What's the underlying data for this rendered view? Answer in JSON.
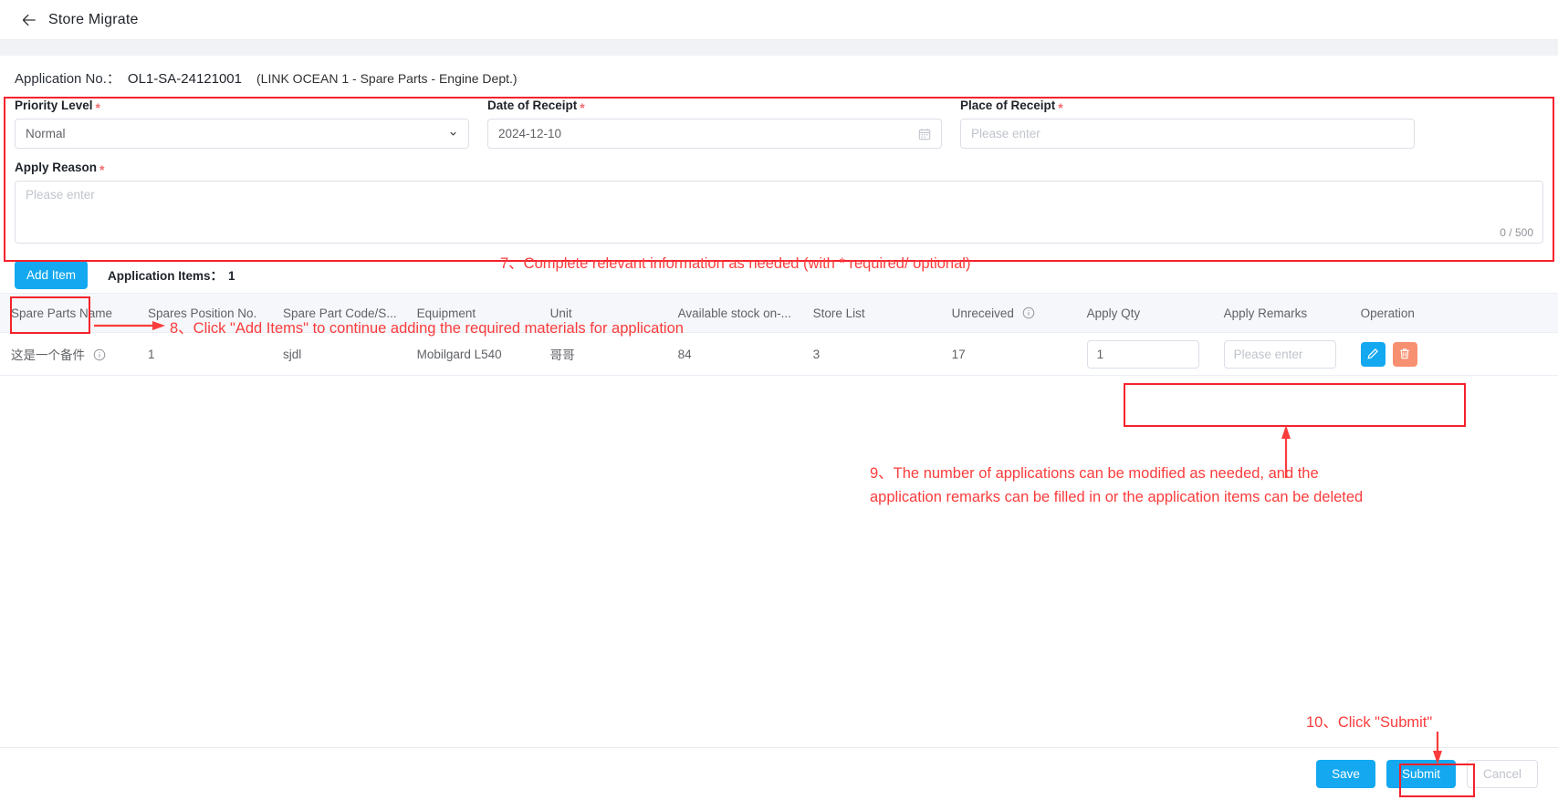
{
  "topbar": {
    "title": "Store Migrate",
    "back_icon": "arrow-left-icon"
  },
  "header": {
    "application_no_label": "Application No.：",
    "application_no_value": "OL1-SA-24121001",
    "vessel_info": "(LINK OCEAN 1 - Spare Parts - Engine Dept.)"
  },
  "form": {
    "priority": {
      "label": "Priority Level",
      "required": "*",
      "value": "Normal",
      "icon": "chevron-down-icon"
    },
    "date_of_receipt": {
      "label": "Date of Receipt",
      "required": "*",
      "value": "2024-12-10",
      "icon": "calendar-icon"
    },
    "place_of_receipt": {
      "label": "Place of Receipt",
      "required": "*",
      "value": "",
      "placeholder": "Please enter"
    },
    "apply_reason": {
      "label": "Apply Reason",
      "required": "*",
      "value": "",
      "placeholder": "Please enter",
      "counter": "0 / 500"
    }
  },
  "toolbar": {
    "add_item_label": "Add Item",
    "application_items_label": "Application Items：",
    "application_items_count": "1"
  },
  "table": {
    "columns": [
      "Spare Parts Name",
      "Spares Position No.",
      "Spare Part Code/S...",
      "Equipment",
      "Unit",
      "Available stock on-...",
      "Store List",
      "Unreceived",
      "Apply Qty",
      "Apply Remarks",
      "Operation"
    ],
    "unreceived_info_icon": "info-circle-icon",
    "rows": [
      {
        "spare_parts_name": "这是一个备件",
        "name_info_icon": "info-circle-icon",
        "spares_position_no": "1",
        "spare_part_code": "sjdl",
        "equipment": "Mobilgard L540",
        "unit": "哥哥",
        "available_stock": "84",
        "store_list": "3",
        "unreceived": "17",
        "apply_qty": "1",
        "apply_remarks_placeholder": "Please enter",
        "edit_icon": "pencil-icon",
        "delete_icon": "trash-icon"
      }
    ]
  },
  "annotations": [
    {
      "id": "step7",
      "text": "7、Complete relevant information as needed (with * required/ optional)"
    },
    {
      "id": "step8",
      "text": "8、Click \"Add Items\" to continue adding the required materials for application"
    },
    {
      "id": "step9_line1",
      "text": "9、The number of applications can be modified as needed, and the"
    },
    {
      "id": "step9_line2",
      "text": "application remarks can be filled in or the application items can be deleted"
    },
    {
      "id": "step10",
      "text": "10、Click \"Submit\""
    }
  ],
  "footer": {
    "save_label": "Save",
    "submit_label": "Submit",
    "cancel_label": "Cancel"
  },
  "colors": {
    "primary": "#13a8f0",
    "annotation_red": "#fa3c3c",
    "highlight_border": "#f5222d",
    "delete_btn": "#f79071",
    "required_star": "#f56c6c"
  }
}
